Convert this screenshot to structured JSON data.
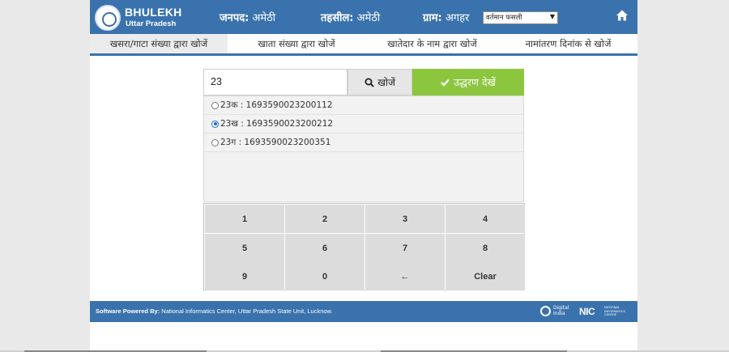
{
  "header": {
    "brand_title": "BHULEKH",
    "brand_subtitle": "Uttar Pradesh",
    "district_label": "जनपद:",
    "district_value": "अमेठी",
    "tehsil_label": "तहसील:",
    "tehsil_value": "अमेठी",
    "village_label": "ग्राम:",
    "village_value": "अगहर",
    "fasli_select_value": "वर्तमान फसली"
  },
  "tabs": [
    {
      "label": "खसरा/गाटा संख्या द्वारा खोजें",
      "active": true
    },
    {
      "label": "खाता संख्या द्वारा खोजें",
      "active": false
    },
    {
      "label": "खातेदार के नाम द्वारा खोजें",
      "active": false
    },
    {
      "label": "नामांतरण दिनांक से खोजें",
      "active": false
    }
  ],
  "search": {
    "input_value": "23",
    "search_button_label": "खोजें",
    "view_button_label": "उद्धरण देखें"
  },
  "results": [
    {
      "label": "23क : 1693590023200112",
      "selected": false
    },
    {
      "label": "23ख : 1693590023200212",
      "selected": true
    },
    {
      "label": "23ग : 1693590023200351",
      "selected": false
    }
  ],
  "keypad": {
    "keys": [
      "1",
      "2",
      "3",
      "4",
      "5",
      "6",
      "7",
      "8",
      "9",
      "0",
      "←",
      "Clear"
    ]
  },
  "footer": {
    "powered_by_label": "Software Powered By:",
    "powered_by_text": "National Informatics Center, Uttar Pradesh State Unit, Lucknow.",
    "digital_india_line1": "Digital",
    "digital_india_line2": "India",
    "nic_mark": "NIC",
    "nic_line1": "NATIONAL",
    "nic_line2": "INFORMATICS",
    "nic_line3": "CENTRE"
  },
  "colors": {
    "header_blue": "#3a72ad",
    "view_button_green": "#8cc63f",
    "key_gray": "#dcdcdc"
  }
}
